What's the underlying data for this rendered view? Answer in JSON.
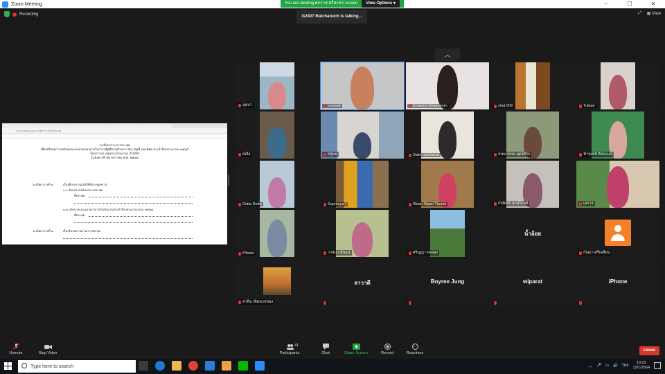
{
  "window": {
    "title": "Zoom Meeting"
  },
  "banner": {
    "viewing_text": "You are viewing ศกราช ศรีสะท's screen",
    "view_options": "View Options ▾"
  },
  "status": {
    "recording": "Recording",
    "talking": "G2407-Ratchanuch is talking...",
    "view": "View"
  },
  "share": {
    "url": "C:/Users/HP/Desktop/ระเบียบวาระการประชุม.pdf",
    "title_lines": [
      "ระเบียบวาระการประชุม",
      "เพื่อเตรียมความพร้อมและทบทวนแนวทางในการปฏิบัติงานด้านการเงิน บัญชี และพัสดุ ประจำปีงบประมาณ ๒๕๖๔",
      "โดยการประชุมผ่านโปรแกรม ZOOM",
      "วันอังคารที่ ๑๒ มกราคม พ.ศ. ๒๕๖๔"
    ],
    "agenda1": "ระเบียบวาระที่ ๑",
    "agenda1_text": "เรื่องที่ประธานแจ้งให้ที่ประชุมทราบ",
    "item11": "๑.๑  วัตถุประสงค์ของการประชุม",
    "item11_sub": "ที่ประชุม",
    "item12": "๑.๒  นโยบายและแนวทางการดำเนินงานประจำปีงบประมาณ พ.ศ. ๒๕๖๔",
    "item12_sub": "ที่ประชุม",
    "agenda2": "ระเบียบวาระที่ ๒",
    "agenda2_text": "เรื่องรับรองรายงานการประชุม"
  },
  "participants_grid": [
    "บุษบา",
    "surasak",
    "Kruanrat Kiramatorn",
    "sirat 009",
    "Tuktae",
    "คณึง",
    "ครูพอ",
    "Dalin nutchanat",
    "ธนนวรรณ บุตรดีงิ่ก",
    "ฟ้ารุ่งชลี ศิลปะนก",
    "Dotta Dotta",
    "Supreeya I",
    "Waan Waan Tiwalai",
    "กัลยิณีย์ ปกษ์ใบขจี",
    "เอกวร",
    "iPhone",
    "วาสนา ห้นแน่",
    "ศริญญา ทองผง",
    "น้ำอ้อย",
    "กัณยา ศรีเคลือบ",
    "สาลิน เพิ่มพวกของ",
    "ลาวาดี",
    "Boyree Jung",
    "wiparat",
    "iPhone"
  ],
  "toolbar": {
    "unmute": "Unmute",
    "stop_video": "Stop Video",
    "participants": "Participants",
    "participants_count": "41",
    "chat": "Chat",
    "share_screen": "Share Screen",
    "record": "Record",
    "reactions": "Reactions",
    "leave": "Leave"
  },
  "taskbar": {
    "search": "Type here to search",
    "time": "10:23",
    "date": "12/1/2564",
    "lang": "ไทย"
  },
  "colors": {
    "zoom_blue": "#2d8cff",
    "share_green": "#25a344",
    "leave_red": "#d9372d",
    "avatar_orange": "#f58027"
  }
}
